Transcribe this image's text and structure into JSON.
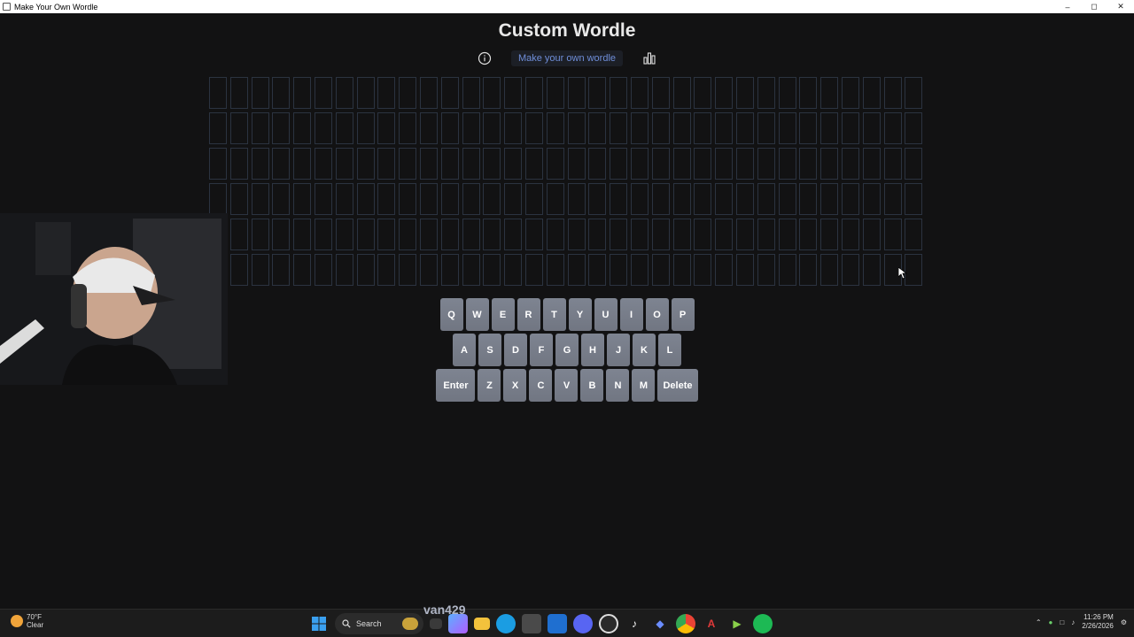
{
  "window": {
    "title": "Make Your Own Wordle",
    "minimize_icon": "minimize-icon",
    "maximize_icon": "maximize-icon",
    "close_icon": "close-icon"
  },
  "page": {
    "heading": "Custom Wordle",
    "make_link": "Make your own wordle",
    "info_icon": "info-icon",
    "stats_icon": "bar-chart-icon"
  },
  "keyboard": {
    "row1": [
      "Q",
      "W",
      "E",
      "R",
      "T",
      "Y",
      "U",
      "I",
      "O",
      "P"
    ],
    "row2": [
      "A",
      "S",
      "D",
      "F",
      "G",
      "H",
      "J",
      "K",
      "L"
    ],
    "row3": [
      "Enter",
      "Z",
      "X",
      "C",
      "V",
      "B",
      "N",
      "M",
      "Delete"
    ]
  },
  "taskbar": {
    "temperature": "70°F",
    "weather": "Clear",
    "search_label": "Search",
    "overlay_name": "van429",
    "time": "11:26 PM",
    "date": "2/26/2026"
  },
  "colors": {
    "background": "#121213",
    "cell_border": "#2b3340",
    "key_bg": "#7e8491",
    "link": "#6f8ed9"
  }
}
